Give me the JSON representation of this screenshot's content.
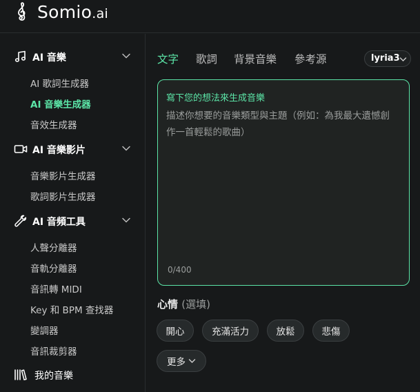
{
  "brand": {
    "name": "Somio",
    "suffix": ".ai"
  },
  "sidebar": {
    "sections": [
      {
        "label": "AI 音樂",
        "icon": "music-note-icon",
        "items": [
          {
            "label": "AI 歌詞生成器",
            "active": false
          },
          {
            "label": "AI 音樂生成器",
            "active": true
          },
          {
            "label": "音效生成器",
            "active": false
          }
        ]
      },
      {
        "label": "AI 音樂影片",
        "icon": "video-camera-icon",
        "items": [
          {
            "label": "音樂影片生成器",
            "active": false
          },
          {
            "label": "歌詞影片生成器",
            "active": false
          }
        ]
      },
      {
        "label": "AI 音頻工具",
        "icon": "wrench-icon",
        "items": [
          {
            "label": "人聲分離器",
            "active": false
          },
          {
            "label": "音軌分離器",
            "active": false
          },
          {
            "label": "音訊轉 MIDI",
            "active": false
          },
          {
            "label": "Key 和 BPM 查找器",
            "active": false
          },
          {
            "label": "變調器",
            "active": false
          },
          {
            "label": "音訊裁剪器",
            "active": false
          }
        ]
      }
    ],
    "library": {
      "label": "我的音樂",
      "icon": "library-icon"
    }
  },
  "tabs": [
    {
      "label": "文字",
      "active": true
    },
    {
      "label": "歌詞",
      "active": false
    },
    {
      "label": "背景音樂",
      "active": false
    },
    {
      "label": "參考源",
      "active": false
    }
  ],
  "model_select": {
    "value": "lyria3"
  },
  "editor": {
    "title": "寫下您的想法來生成音樂",
    "placeholder": "描述你想要的音樂類型與主題（例如：為我最大遺憾創作一首輕鬆的歌曲）",
    "counter": "0/400"
  },
  "mood": {
    "title": "心情",
    "optional": "(選填)",
    "chips": [
      "開心",
      "充滿活力",
      "放鬆",
      "悲傷"
    ],
    "more_label": "更多"
  },
  "colors": {
    "accent": "#5ce6a8",
    "background": "#17191a",
    "panel": "#202322",
    "chip": "#262a2b"
  }
}
